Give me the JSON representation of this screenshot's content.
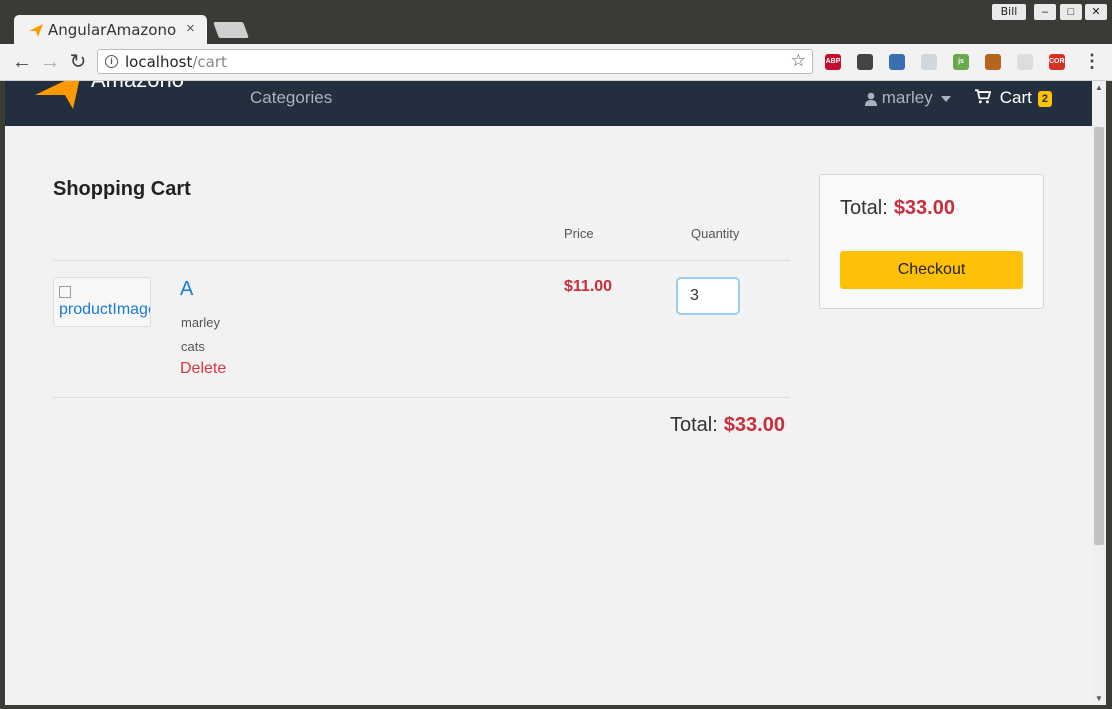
{
  "window": {
    "tab_title": "AngularAmazono",
    "tab_close": "×",
    "user_name": "Bill",
    "min_glyph": "–",
    "max_glyph": "□",
    "close_glyph": "✕"
  },
  "toolbar": {
    "back_glyph": "←",
    "forward_glyph": "→",
    "reload_glyph": "↻",
    "url_host": "localhost",
    "url_path": "/cart",
    "star_glyph": "☆",
    "menu_glyph": "⋮",
    "extensions": [
      {
        "name": "adblock-plus-icon",
        "label": "ABP",
        "color": "#c70d2c"
      },
      {
        "name": "sync-icon",
        "label": "",
        "color": "#444444"
      },
      {
        "name": "color-picker-icon",
        "label": "",
        "color": "#3a6fb0"
      },
      {
        "name": "react-devtools-icon",
        "label": "",
        "color": "#cfd8dc"
      },
      {
        "name": "js-icon",
        "label": "js",
        "color": "#6aa84f"
      },
      {
        "name": "monkey-icon",
        "label": "",
        "color": "#b5651d"
      },
      {
        "name": "circle-ext-icon",
        "label": "",
        "color": "#dddddd"
      },
      {
        "name": "cors-icon",
        "label": "CORS",
        "color": "#d93025"
      }
    ]
  },
  "site": {
    "brand": "Amazono",
    "nav_categories": "Categories",
    "user": "marley",
    "cart_label": "Cart",
    "cart_count": "2"
  },
  "cart": {
    "heading": "Shopping Cart",
    "col_price": "Price",
    "col_quantity": "Quantity",
    "item": {
      "image_alt": "productImage",
      "name": "A",
      "seller": "marley",
      "category": "cats",
      "delete_label": "Delete",
      "price": "$11.00",
      "quantity": "3"
    },
    "total_label": "Total:",
    "total_amount": "$33.00"
  },
  "summary": {
    "total_label": "Total:",
    "total_amount": "$33.00",
    "checkout_label": "Checkout"
  },
  "colors": {
    "navbar": "#232f3e",
    "accent_yellow": "#ffc107",
    "price_red": "#c62f3b",
    "link_blue": "#1a7bd8"
  }
}
